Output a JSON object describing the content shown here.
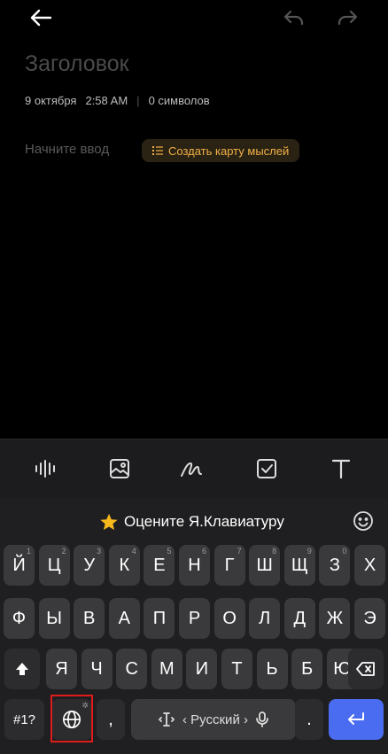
{
  "note": {
    "title_placeholder": "Заголовок",
    "date": "9 октября",
    "time": "2:58 AM",
    "char_count": "0 символов",
    "body_placeholder": "Начните ввод",
    "mindmap_button": "Создать карту мыслей"
  },
  "toolbar_icons": [
    "voice-wave-icon",
    "image-icon",
    "handwriting-icon",
    "checkbox-icon",
    "text-format-icon"
  ],
  "keyboard": {
    "suggestion": "Оцените Я.Клавиатуру",
    "row1": [
      {
        "k": "Й",
        "h": "1"
      },
      {
        "k": "Ц",
        "h": "2"
      },
      {
        "k": "У",
        "h": "3"
      },
      {
        "k": "К",
        "h": "4"
      },
      {
        "k": "Е",
        "h": "5"
      },
      {
        "k": "Н",
        "h": "6"
      },
      {
        "k": "Г",
        "h": "7"
      },
      {
        "k": "Ш",
        "h": "8"
      },
      {
        "k": "Щ",
        "h": "9"
      },
      {
        "k": "З",
        "h": "0"
      },
      {
        "k": "Х",
        "h": ""
      }
    ],
    "row2": [
      "Ф",
      "Ы",
      "В",
      "А",
      "П",
      "Р",
      "О",
      "Л",
      "Д",
      "Ж",
      "Э"
    ],
    "row3": [
      "Я",
      "Ч",
      "С",
      "М",
      "И",
      "Т",
      "Ь",
      "Б",
      "Ю"
    ],
    "symbols_key": "#1?",
    "comma_key": ",",
    "space_label": "‹ Русский ›",
    "period_key": "."
  }
}
